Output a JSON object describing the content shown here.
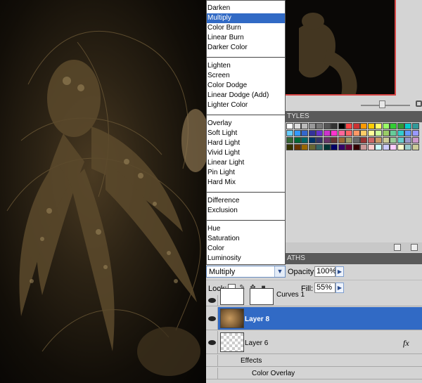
{
  "dropdown": {
    "groups": [
      [
        "Darken",
        "Multiply",
        "Color Burn",
        "Linear Burn",
        "Darker Color"
      ],
      [
        "Lighten",
        "Screen",
        "Color Dodge",
        "Linear Dodge (Add)",
        "Lighter Color"
      ],
      [
        "Overlay",
        "Soft Light",
        "Hard Light",
        "Vivid Light",
        "Linear Light",
        "Pin Light",
        "Hard Mix"
      ],
      [
        "Difference",
        "Exclusion"
      ],
      [
        "Hue",
        "Saturation",
        "Color",
        "Luminosity"
      ]
    ],
    "selected": "Multiply"
  },
  "panels": {
    "styles_tab": "TYLES",
    "layers_tab": "ATHS"
  },
  "blend": {
    "mode": "Multiply",
    "opacity_label": "Opacity:",
    "opacity": "100%"
  },
  "lock": {
    "label": "Lock:",
    "fill_label": "Fill:",
    "fill": "55%"
  },
  "layers": {
    "curves": "Curves 1",
    "layer8": "Layer 8",
    "layer6": "Layer 6",
    "fx": "fx",
    "effects": "Effects",
    "color_overlay": "Color Overlay"
  },
  "colors": {
    "selection": "#316ac5",
    "nav_frame": "#d64545"
  }
}
